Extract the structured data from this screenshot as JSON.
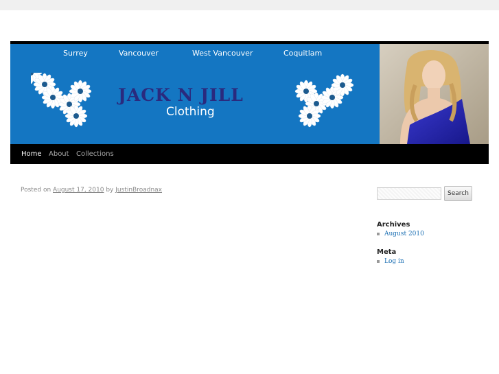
{
  "banner": {
    "cities": [
      "Surrey",
      "Vancouver",
      "West Vancouver",
      "Coquitlam"
    ],
    "brand_title": "JACK N JILL",
    "brand_subtitle": "Clothing",
    "colors": {
      "banner_bg": "#1476c2",
      "title": "#2a2a7e"
    }
  },
  "nav": {
    "items": [
      {
        "label": "Home",
        "active": true
      },
      {
        "label": "About",
        "active": false
      },
      {
        "label": "Collections",
        "active": false
      }
    ]
  },
  "post": {
    "posted_on_prefix": "Posted on",
    "date": "August 17, 2010",
    "by_word": "by",
    "author": "JustinBroadnax"
  },
  "sidebar": {
    "search": {
      "placeholder": "",
      "button_label": "Search"
    },
    "archives": {
      "title": "Archives",
      "items": [
        "August 2010"
      ]
    },
    "meta": {
      "title": "Meta",
      "items": [
        "Log in"
      ]
    }
  }
}
